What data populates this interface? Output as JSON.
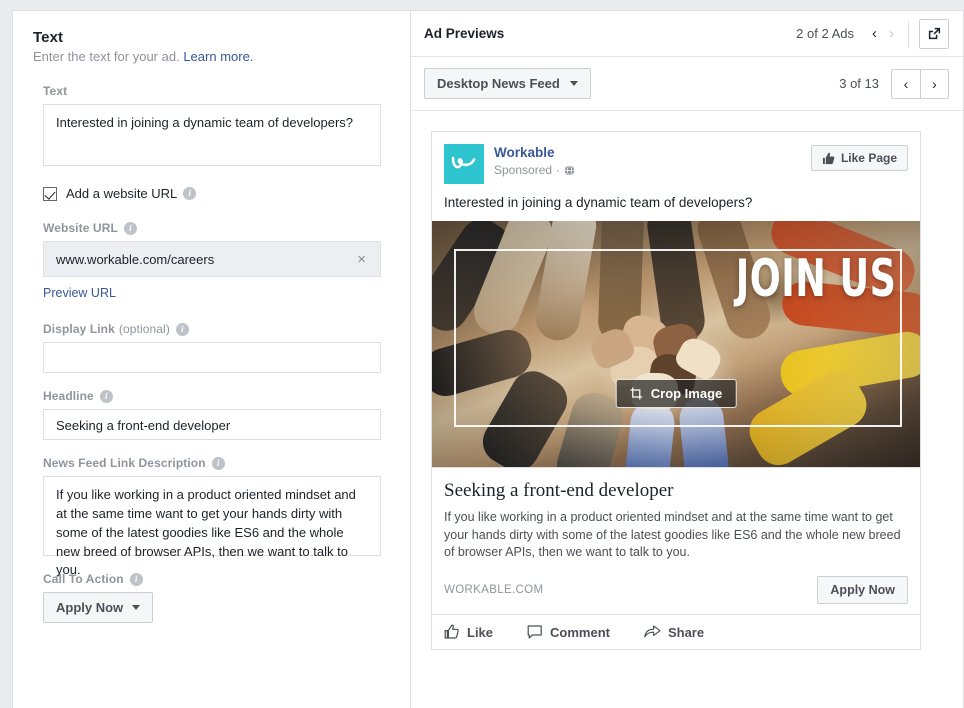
{
  "left": {
    "section_title": "Text",
    "section_sub_text": "Enter the text for your ad.",
    "learn_more": "Learn more.",
    "text_label": "Text",
    "text_value": "Interested in joining a dynamic team of developers?",
    "checkbox_label": "Add a website URL",
    "website_url_label": "Website URL",
    "website_url_value": "www.workable.com/careers",
    "clear_glyph": "×",
    "preview_url_link": "Preview URL",
    "display_link_label": "Display Link",
    "display_link_optional": "(optional)",
    "display_link_value": "",
    "headline_label": "Headline",
    "headline_value": "Seeking a front-end developer",
    "description_label": "News Feed Link Description",
    "description_value": "If you like working in a product oriented mindset and at the same time want to get your hands dirty with some of the latest goodies like ES6 and the whole new breed of browser APIs, then we want to talk to you.",
    "cta_label": "Call To Action",
    "cta_value": "Apply Now"
  },
  "right": {
    "header_title": "Ad Previews",
    "ads_count": "2 of 2 Ads",
    "prev_glyph": "‹",
    "next_glyph": "›",
    "placement_select": "Desktop News Feed",
    "placement_count": "3 of 13"
  },
  "ad": {
    "brand_name": "Workable",
    "sponsored": "Sponsored",
    "sponsored_sep": "·",
    "like_page": "Like Page",
    "message": "Interested in joining a dynamic team of developers?",
    "image_overlay_text": "JOIN US",
    "crop_button": "Crop Image",
    "headline": "Seeking a front-end developer",
    "description": "If you like working in a product oriented mindset and at the same time want to get your hands dirty with some of the latest goodies like ES6 and the whole new breed of browser APIs, then we want to talk to you.",
    "domain": "WORKABLE.COM",
    "cta_button": "Apply Now",
    "action_like": "Like",
    "action_comment": "Comment",
    "action_share": "Share"
  },
  "colors": {
    "brand_teal": "#2ec4cf",
    "link_blue": "#385898",
    "label_grey": "#90949c",
    "text_dark": "#1d2129",
    "border": "#dddfe2",
    "page_bg": "#e9ebee"
  }
}
